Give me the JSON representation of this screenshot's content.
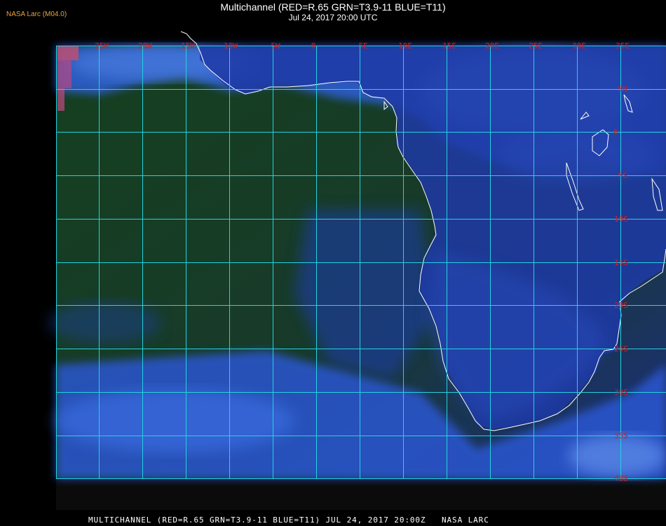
{
  "header": {
    "source": "NASA Larc (M04.0)",
    "title": "Multichannel (RED=R.65 GRN=T3.9-11 BLUE=T11)",
    "subtitle": "Jul 24, 2017 20:00 UTC"
  },
  "footer": {
    "caption": "MULTICHANNEL (RED=R.65 GRN=T3.9-11 BLUE=T11) JUL 24, 2017 20:00Z   NASA LARC"
  },
  "map": {
    "longitude_labels": [
      "25W",
      "20W",
      "15W",
      "10W",
      "5W",
      "0",
      "5E",
      "10E",
      "15E",
      "20E",
      "25E",
      "30E",
      "35E"
    ],
    "latitude_labels": [
      "5N",
      "0",
      "5S",
      "10S",
      "15S",
      "20S",
      "25S",
      "30S",
      "35S",
      "40S"
    ],
    "colors": {
      "grid": "#22d3e0",
      "label": "#d22020",
      "coastline": "#ffffff",
      "ocean_clear": "#163d22",
      "ocean_haze": "#1b3aa0",
      "cloud": "#3a72e8"
    }
  }
}
